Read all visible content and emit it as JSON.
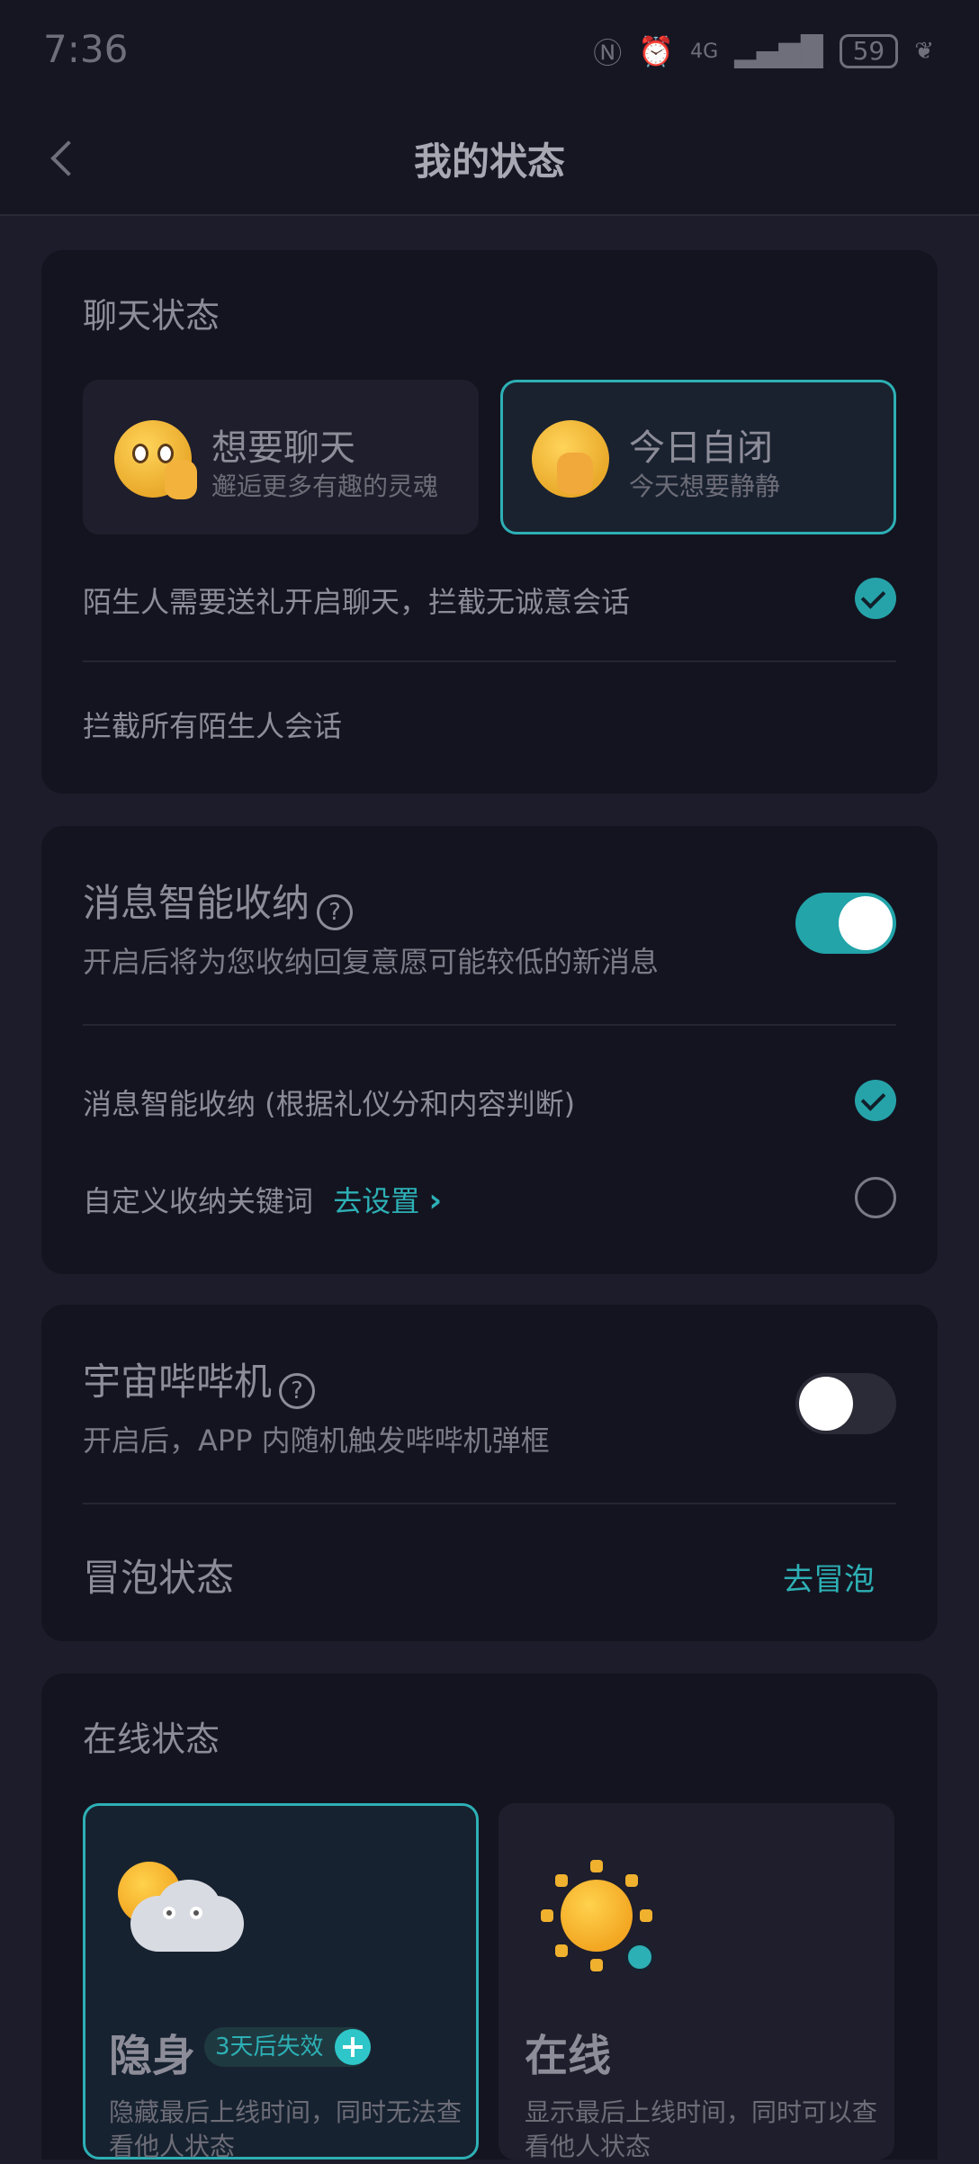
{
  "status_bar": {
    "time": "7:36",
    "network": "4G",
    "battery": "59"
  },
  "header": {
    "title": "我的状态"
  },
  "chat_status": {
    "title": "聊天状态",
    "options": [
      {
        "title": "想要聊天",
        "subtitle": "邂逅更多有趣的灵魂",
        "selected": false
      },
      {
        "title": "今日自闭",
        "subtitle": "今天想要静静",
        "selected": true
      }
    ],
    "rows": [
      {
        "label": "陌生人需要送礼开启聊天，拦截无诚意会话",
        "checked": true
      },
      {
        "label": "拦截所有陌生人会话",
        "checked": false
      }
    ]
  },
  "smart_inbox": {
    "title": "消息智能收纳",
    "help": "?",
    "description": "开启后将为您收纳回复意愿可能较低的新消息",
    "enabled": true,
    "options": [
      {
        "label": "消息智能收纳 (根据礼仪分和内容判断)",
        "checked": true
      },
      {
        "label": "自定义收纳关键词",
        "link": "去设置",
        "link_arrow": "›",
        "checked": false
      }
    ]
  },
  "bibi": {
    "title": "宇宙哔哔机",
    "help": "?",
    "description": "开启后，APP 内随机触发哔哔机弹框",
    "enabled": false,
    "bubble_label": "冒泡状态",
    "bubble_link": "去冒泡"
  },
  "online_status": {
    "title": "在线状态",
    "cards": [
      {
        "title": "隐身",
        "badge": "3天后失效",
        "desc": "隐藏最后上线时间，同时无法查看他人状态",
        "selected": true
      },
      {
        "title": "在线",
        "desc": "显示最后上线时间，同时可以查看他人状态",
        "selected": false
      }
    ]
  },
  "colors": {
    "accent": "#2db0b5",
    "background": "#1c1c2a",
    "card": "#141420"
  }
}
